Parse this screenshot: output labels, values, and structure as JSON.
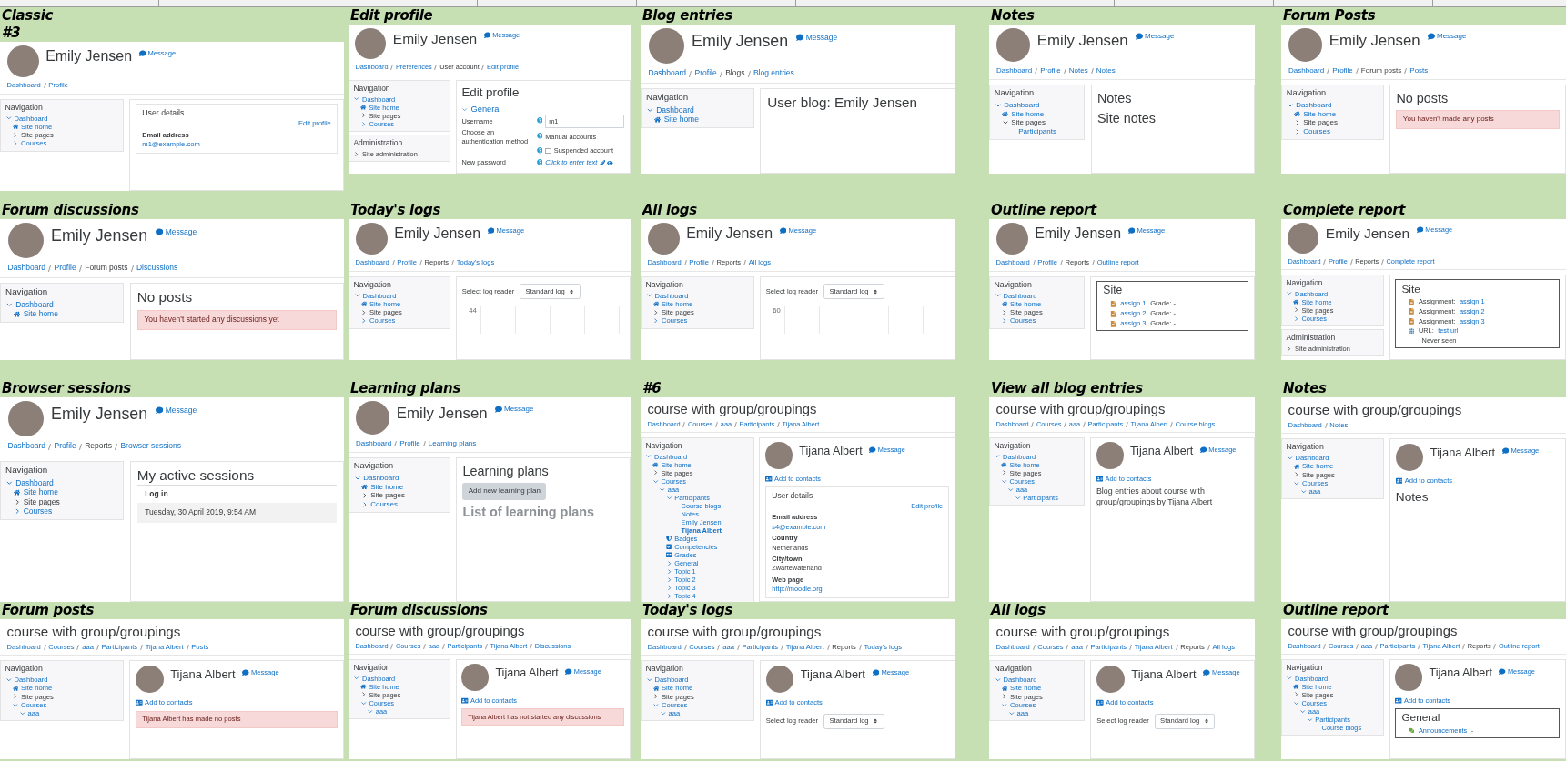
{
  "tiles": [
    {
      "caption": [
        "Classic",
        "#3"
      ],
      "header": {
        "kind": "user",
        "title": "Emily Jensen",
        "message": "Message"
      },
      "breadcrumb": [
        {
          "text": "Dashboard",
          "link": true
        },
        {
          "text": "Profile",
          "link": true
        }
      ],
      "nav": {
        "title": "Navigation",
        "items": [
          {
            "text": "Dashboard",
            "kind": "node",
            "expanded": true,
            "link": true,
            "children": [
              {
                "text": "Site home",
                "kind": "home",
                "link": true
              },
              {
                "text": "Site pages",
                "kind": "node",
                "expanded": false,
                "link": false
              },
              {
                "text": "Courses",
                "kind": "node",
                "expanded": false,
                "link": true
              }
            ]
          }
        ]
      },
      "main": [
        {
          "kind": "card",
          "title": "User details",
          "action": "Edit profile",
          "fields": [
            {
              "label": "Email address",
              "value": "m1@example.com",
              "link": true
            }
          ]
        }
      ]
    },
    {
      "caption": [
        "Edit profile"
      ],
      "header": {
        "kind": "user",
        "title": "Emily Jensen",
        "message": "Message"
      },
      "breadcrumb": [
        {
          "text": "Dashboard",
          "link": true
        },
        {
          "text": "Preferences",
          "link": true
        },
        {
          "text": "User account",
          "link": false
        },
        {
          "text": "Edit profile",
          "link": true
        }
      ],
      "nav": {
        "title": "Navigation",
        "items": [
          {
            "text": "Dashboard",
            "kind": "node",
            "expanded": true,
            "link": true,
            "children": [
              {
                "text": "Site home",
                "kind": "home",
                "link": true
              },
              {
                "text": "Site pages",
                "kind": "node",
                "expanded": false,
                "link": false
              },
              {
                "text": "Courses",
                "kind": "node",
                "expanded": false,
                "link": true
              }
            ]
          }
        ]
      },
      "admin": {
        "title": "Administration",
        "items": [
          {
            "text": "Site administration",
            "kind": "node",
            "expanded": false,
            "link": false
          }
        ]
      },
      "main": [
        {
          "kind": "heading",
          "text": "Edit profile"
        },
        {
          "kind": "form",
          "section": "General",
          "expanded": true,
          "rows": [
            {
              "label": "Username",
              "help": true,
              "kind": "input",
              "value": "m1"
            },
            {
              "label": "Choose an authentication method",
              "help": true,
              "kind": "text",
              "value": "Manual accounts"
            },
            {
              "kind": "checkbox",
              "value": "Suspended account",
              "checked": false,
              "help": true
            },
            {
              "label": "New password",
              "help": true,
              "kind": "editable",
              "value": "Click to enter text"
            }
          ]
        }
      ]
    },
    {
      "caption": [
        "Blog entries"
      ],
      "header": {
        "kind": "user",
        "title": "Emily Jensen",
        "message": "Message"
      },
      "breadcrumb": [
        {
          "text": "Dashboard",
          "link": true
        },
        {
          "text": "Profile",
          "link": true
        },
        {
          "text": "Blogs",
          "link": false
        },
        {
          "text": "Blog entries",
          "link": true
        }
      ],
      "nav": {
        "title": "Navigation",
        "items": [
          {
            "text": "Dashboard",
            "kind": "node",
            "expanded": true,
            "link": true,
            "children": [
              {
                "text": "Site home",
                "kind": "home",
                "link": true
              }
            ]
          }
        ]
      },
      "main": [
        {
          "kind": "heading",
          "text": "User blog: Emily Jensen"
        }
      ]
    },
    {
      "caption": [
        "Notes"
      ],
      "header": {
        "kind": "user",
        "title": "Emily Jensen",
        "message": "Message"
      },
      "breadcrumb": [
        {
          "text": "Dashboard",
          "link": true
        },
        {
          "text": "Profile",
          "link": true
        },
        {
          "text": "Notes",
          "link": true
        },
        {
          "text": "Notes",
          "link": true
        }
      ],
      "nav": {
        "title": "Navigation",
        "items": [
          {
            "text": "Dashboard",
            "kind": "node",
            "expanded": true,
            "link": true,
            "children": [
              {
                "text": "Site home",
                "kind": "home",
                "link": true
              },
              {
                "text": "Site pages",
                "kind": "node",
                "expanded": true,
                "link": false,
                "children": [
                  {
                    "text": "Participants",
                    "kind": "leaf",
                    "link": true
                  }
                ]
              }
            ]
          }
        ]
      },
      "main": [
        {
          "kind": "heading",
          "text": "Notes"
        },
        {
          "kind": "heading",
          "text": "Site notes"
        }
      ]
    },
    {
      "caption": [
        "Forum Posts"
      ],
      "header": {
        "kind": "user",
        "title": "Emily Jensen",
        "message": "Message"
      },
      "breadcrumb": [
        {
          "text": "Dashboard",
          "link": true
        },
        {
          "text": "Profile",
          "link": true
        },
        {
          "text": "Forum posts",
          "link": false
        },
        {
          "text": "Posts",
          "link": true
        }
      ],
      "nav": {
        "title": "Navigation",
        "items": [
          {
            "text": "Dashboard",
            "kind": "node",
            "expanded": true,
            "link": true,
            "children": [
              {
                "text": "Site home",
                "kind": "home",
                "link": true
              },
              {
                "text": "Site pages",
                "kind": "node",
                "expanded": false,
                "link": false
              },
              {
                "text": "Courses",
                "kind": "node",
                "expanded": false,
                "link": true
              }
            ]
          }
        ]
      },
      "main": [
        {
          "kind": "heading",
          "text": "No posts"
        },
        {
          "kind": "alert",
          "text": "You haven't made any posts"
        }
      ]
    },
    {
      "caption": [
        "Forum discussions"
      ],
      "header": {
        "kind": "user",
        "title": "Emily Jensen",
        "message": "Message"
      },
      "breadcrumb": [
        {
          "text": "Dashboard",
          "link": true
        },
        {
          "text": "Profile",
          "link": true
        },
        {
          "text": "Forum posts",
          "link": false
        },
        {
          "text": "Discussions",
          "link": true
        }
      ],
      "nav": {
        "title": "Navigation",
        "items": [
          {
            "text": "Dashboard",
            "kind": "node",
            "expanded": true,
            "link": true,
            "children": [
              {
                "text": "Site home",
                "kind": "home",
                "link": true
              }
            ]
          }
        ]
      },
      "main": [
        {
          "kind": "heading",
          "text": "No posts"
        },
        {
          "kind": "alert",
          "text": "You haven't started any discussions yet"
        }
      ]
    },
    {
      "caption": [
        "Today's logs"
      ],
      "header": {
        "kind": "user",
        "title": "Emily Jensen",
        "message": "Message"
      },
      "breadcrumb": [
        {
          "text": "Dashboard",
          "link": true
        },
        {
          "text": "Profile",
          "link": true
        },
        {
          "text": "Reports",
          "link": false
        },
        {
          "text": "Today's logs",
          "link": true
        }
      ],
      "nav": {
        "title": "Navigation",
        "items": [
          {
            "text": "Dashboard",
            "kind": "node",
            "expanded": true,
            "link": true,
            "children": [
              {
                "text": "Site home",
                "kind": "home",
                "link": true
              },
              {
                "text": "Site pages",
                "kind": "node",
                "expanded": false,
                "link": false
              },
              {
                "text": "Courses",
                "kind": "node",
                "expanded": false,
                "link": true
              }
            ]
          }
        ]
      },
      "main": [
        {
          "kind": "logs",
          "label": "Select log reader",
          "value": "Standard log",
          "tick": "44"
        }
      ]
    },
    {
      "caption": [
        "All logs"
      ],
      "header": {
        "kind": "user",
        "title": "Emily Jensen",
        "message": "Message"
      },
      "breadcrumb": [
        {
          "text": "Dashboard",
          "link": true
        },
        {
          "text": "Profile",
          "link": true
        },
        {
          "text": "Reports",
          "link": false
        },
        {
          "text": "All logs",
          "link": true
        }
      ],
      "nav": {
        "title": "Navigation",
        "items": [
          {
            "text": "Dashboard",
            "kind": "node",
            "expanded": true,
            "link": true,
            "children": [
              {
                "text": "Site home",
                "kind": "home",
                "link": true
              },
              {
                "text": "Site pages",
                "kind": "node",
                "expanded": false,
                "link": false
              },
              {
                "text": "Courses",
                "kind": "node",
                "expanded": false,
                "link": true
              }
            ]
          }
        ]
      },
      "main": [
        {
          "kind": "logs",
          "label": "Select log reader",
          "value": "Standard log",
          "tick": "60"
        }
      ]
    },
    {
      "caption": [
        "Outline report"
      ],
      "header": {
        "kind": "user",
        "title": "Emily Jensen",
        "message": "Message"
      },
      "breadcrumb": [
        {
          "text": "Dashboard",
          "link": true
        },
        {
          "text": "Profile",
          "link": true
        },
        {
          "text": "Reports",
          "link": false
        },
        {
          "text": "Outline report",
          "link": true
        }
      ],
      "nav": {
        "title": "Navigation",
        "items": [
          {
            "text": "Dashboard",
            "kind": "node",
            "expanded": true,
            "link": true,
            "children": [
              {
                "text": "Site home",
                "kind": "home",
                "link": true
              },
              {
                "text": "Site pages",
                "kind": "node",
                "expanded": false,
                "link": false
              },
              {
                "text": "Courses",
                "kind": "node",
                "expanded": false,
                "link": true
              }
            ]
          }
        ]
      },
      "main": [
        {
          "kind": "report",
          "title": "Site",
          "rows": [
            {
              "kind": "assign",
              "link": "assign 1",
              "after": "Grade: -"
            },
            {
              "kind": "assign",
              "link": "assign 2",
              "after": "Grade: -"
            },
            {
              "kind": "assign",
              "link": "assign 3",
              "after": "Grade: -"
            }
          ]
        }
      ]
    },
    {
      "caption": [
        "Complete report"
      ],
      "header": {
        "kind": "user",
        "title": "Emily Jensen",
        "message": "Message"
      },
      "breadcrumb": [
        {
          "text": "Dashboard",
          "link": true
        },
        {
          "text": "Profile",
          "link": true
        },
        {
          "text": "Reports",
          "link": false
        },
        {
          "text": "Complete report",
          "link": true
        }
      ],
      "nav": {
        "title": "Navigation",
        "items": [
          {
            "text": "Dashboard",
            "kind": "node",
            "expanded": true,
            "link": true,
            "children": [
              {
                "text": "Site home",
                "kind": "home",
                "link": true
              },
              {
                "text": "Site pages",
                "kind": "node",
                "expanded": false,
                "link": false
              },
              {
                "text": "Courses",
                "kind": "node",
                "expanded": false,
                "link": true
              }
            ]
          }
        ]
      },
      "admin": {
        "title": "Administration",
        "items": [
          {
            "text": "Site administration",
            "kind": "node",
            "expanded": false,
            "link": false
          }
        ]
      },
      "main": [
        {
          "kind": "report",
          "title": "Site",
          "rows": [
            {
              "kind": "assign",
              "before": "Assignment:",
              "link": "assign 1"
            },
            {
              "kind": "assign",
              "before": "Assignment:",
              "link": "assign 2"
            },
            {
              "kind": "assign",
              "before": "Assignment:",
              "link": "assign 3"
            },
            {
              "kind": "url",
              "before": "URL:",
              "link": "test url"
            }
          ],
          "note": "Never seen"
        }
      ]
    },
    {
      "caption": [
        "Browser sessions"
      ],
      "header": {
        "kind": "user",
        "title": "Emily Jensen",
        "message": "Message"
      },
      "breadcrumb": [
        {
          "text": "Dashboard",
          "link": true
        },
        {
          "text": "Profile",
          "link": true
        },
        {
          "text": "Reports",
          "link": false
        },
        {
          "text": "Browser sessions",
          "link": true
        }
      ],
      "nav": {
        "title": "Navigation",
        "items": [
          {
            "text": "Dashboard",
            "kind": "node",
            "expanded": true,
            "link": true,
            "children": [
              {
                "text": "Site home",
                "kind": "home",
                "link": true
              },
              {
                "text": "Site pages",
                "kind": "node",
                "expanded": false,
                "link": false
              },
              {
                "text": "Courses",
                "kind": "node",
                "expanded": false,
                "link": true
              }
            ]
          }
        ]
      },
      "main": [
        {
          "kind": "sessions",
          "title": "My active sessions",
          "column": "Log in",
          "row": "Tuesday, 30 April 2019, 9:54 AM"
        }
      ]
    },
    {
      "caption": [
        "Learning plans"
      ],
      "header": {
        "kind": "user",
        "title": "Emily Jensen",
        "message": "Message"
      },
      "breadcrumb": [
        {
          "text": "Dashboard",
          "link": true
        },
        {
          "text": "Profile",
          "link": true
        },
        {
          "text": "Learning plans",
          "link": true
        }
      ],
      "nav": {
        "title": "Navigation",
        "items": [
          {
            "text": "Dashboard",
            "kind": "node",
            "expanded": true,
            "link": true,
            "children": [
              {
                "text": "Site home",
                "kind": "home",
                "link": true
              },
              {
                "text": "Site pages",
                "kind": "node",
                "expanded": false,
                "link": false
              },
              {
                "text": "Courses",
                "kind": "node",
                "expanded": false,
                "link": true
              }
            ]
          }
        ]
      },
      "main": [
        {
          "kind": "heading",
          "text": "Learning plans"
        },
        {
          "kind": "button",
          "text": "Add new learning plan"
        },
        {
          "kind": "heading",
          "text": "List of learning plans",
          "muted": true
        }
      ]
    },
    {
      "caption": [
        "#6"
      ],
      "header": {
        "kind": "course",
        "title": "course with group/groupings"
      },
      "breadcrumb": [
        {
          "text": "Dashboard",
          "link": true
        },
        {
          "text": "Courses",
          "link": true
        },
        {
          "text": "aaa",
          "link": true
        },
        {
          "text": "Participants",
          "link": true
        },
        {
          "text": "Tijana Albert",
          "link": true
        }
      ],
      "nav": {
        "title": "Navigation",
        "items": [
          {
            "text": "Dashboard",
            "kind": "node",
            "expanded": true,
            "link": true,
            "children": [
              {
                "text": "Site home",
                "kind": "home",
                "link": true
              },
              {
                "text": "Site pages",
                "kind": "node",
                "expanded": false,
                "link": false
              },
              {
                "text": "Courses",
                "kind": "node",
                "expanded": true,
                "link": true,
                "children": [
                  {
                    "text": "aaa",
                    "kind": "node",
                    "expanded": true,
                    "link": true,
                    "children": [
                      {
                        "text": "Participants",
                        "kind": "node",
                        "expanded": true,
                        "link": true,
                        "children": [
                          {
                            "text": "Course blogs",
                            "kind": "leaf",
                            "link": true
                          },
                          {
                            "text": "Notes",
                            "kind": "leaf",
                            "link": true
                          },
                          {
                            "text": "Emily Jensen",
                            "kind": "leaf",
                            "link": true
                          },
                          {
                            "text": "Tijana Albert",
                            "kind": "leaf",
                            "link": true,
                            "current": true
                          }
                        ]
                      },
                      {
                        "text": "Badges",
                        "kind": "badges",
                        "link": true
                      },
                      {
                        "text": "Competencies",
                        "kind": "competencies",
                        "link": true
                      },
                      {
                        "text": "Grades",
                        "kind": "grades",
                        "link": true
                      },
                      {
                        "text": "General",
                        "kind": "node",
                        "expanded": false,
                        "link": true
                      },
                      {
                        "text": "Topic 1",
                        "kind": "node",
                        "expanded": false,
                        "link": true
                      },
                      {
                        "text": "Topic 2",
                        "kind": "node",
                        "expanded": false,
                        "link": true
                      },
                      {
                        "text": "Topic 3",
                        "kind": "node",
                        "expanded": false,
                        "link": true
                      },
                      {
                        "text": "Topic 4",
                        "kind": "node",
                        "expanded": false,
                        "link": true
                      }
                    ]
                  }
                ]
              }
            ]
          }
        ]
      },
      "main": [
        {
          "kind": "user",
          "name": "Tijana Albert",
          "message": "Message",
          "contacts": "Add to contacts"
        },
        {
          "kind": "card",
          "title": "User details",
          "action": "Edit profile",
          "fields": [
            {
              "label": "Email address",
              "value": "s4@example.com",
              "link": true
            },
            {
              "label": "Country",
              "value": "Netherlands",
              "link": false
            },
            {
              "label": "City/town",
              "value": "Zwartewaterland",
              "link": false
            },
            {
              "label": "Web page",
              "value": "http://moodle.org",
              "link": true
            }
          ]
        }
      ]
    },
    {
      "caption": [
        "View all blog entries"
      ],
      "header": {
        "kind": "course",
        "title": "course with group/groupings"
      },
      "breadcrumb": [
        {
          "text": "Dashboard",
          "link": true
        },
        {
          "text": "Courses",
          "link": true
        },
        {
          "text": "aaa",
          "link": true
        },
        {
          "text": "Participants",
          "link": true
        },
        {
          "text": "Tijana Albert",
          "link": true
        },
        {
          "text": "Course blogs",
          "link": true
        }
      ],
      "nav": {
        "title": "Navigation",
        "items": [
          {
            "text": "Dashboard",
            "kind": "node",
            "expanded": true,
            "link": true,
            "children": [
              {
                "text": "Site home",
                "kind": "home",
                "link": true
              },
              {
                "text": "Site pages",
                "kind": "node",
                "expanded": false,
                "link": false
              },
              {
                "text": "Courses",
                "kind": "node",
                "expanded": true,
                "link": true,
                "children": [
                  {
                    "text": "aaa",
                    "kind": "node",
                    "expanded": true,
                    "link": true,
                    "children": [
                      {
                        "text": "Participants",
                        "kind": "node",
                        "expanded": true,
                        "link": true
                      }
                    ]
                  }
                ]
              }
            ]
          }
        ]
      },
      "main": [
        {
          "kind": "user",
          "name": "Tijana Albert",
          "message": "Message",
          "contacts": "Add to contacts"
        },
        {
          "kind": "text",
          "text": "Blog entries about course with group/groupings by Tijana Albert"
        }
      ]
    },
    {
      "caption": [
        "Notes"
      ],
      "header": {
        "kind": "course",
        "title": "course with group/groupings"
      },
      "breadcrumb": [
        {
          "text": "Dashboard",
          "link": true
        },
        {
          "text": "Notes",
          "link": true
        }
      ],
      "nav": {
        "title": "Navigation",
        "items": [
          {
            "text": "Dashboard",
            "kind": "node",
            "expanded": true,
            "link": true,
            "children": [
              {
                "text": "Site home",
                "kind": "home",
                "link": true
              },
              {
                "text": "Site pages",
                "kind": "node",
                "expanded": false,
                "link": false
              },
              {
                "text": "Courses",
                "kind": "node",
                "expanded": true,
                "link": true,
                "children": [
                  {
                    "text": "aaa",
                    "kind": "node",
                    "expanded": true,
                    "link": true
                  }
                ]
              }
            ]
          }
        ]
      },
      "main": [
        {
          "kind": "user",
          "name": "Tijana Albert",
          "message": "Message",
          "contacts": "Add to contacts"
        },
        {
          "kind": "heading",
          "text": "Notes"
        }
      ]
    },
    {
      "caption": [
        "Forum posts"
      ],
      "header": {
        "kind": "course",
        "title": "course with group/groupings"
      },
      "breadcrumb": [
        {
          "text": "Dashboard",
          "link": true
        },
        {
          "text": "Courses",
          "link": true
        },
        {
          "text": "aaa",
          "link": true
        },
        {
          "text": "Participants",
          "link": true
        },
        {
          "text": "Tijana Albert",
          "link": true
        },
        {
          "text": "Posts",
          "link": true
        }
      ],
      "nav": {
        "title": "Navigation",
        "items": [
          {
            "text": "Dashboard",
            "kind": "node",
            "expanded": true,
            "link": true,
            "children": [
              {
                "text": "Site home",
                "kind": "home",
                "link": true
              },
              {
                "text": "Site pages",
                "kind": "node",
                "expanded": false,
                "link": false
              },
              {
                "text": "Courses",
                "kind": "node",
                "expanded": true,
                "link": true,
                "children": [
                  {
                    "text": "aaa",
                    "kind": "node",
                    "expanded": true,
                    "link": true
                  }
                ]
              }
            ]
          }
        ]
      },
      "main": [
        {
          "kind": "user",
          "name": "Tijana Albert",
          "message": "Message",
          "contacts": "Add to contacts"
        },
        {
          "kind": "alert",
          "text": "Tijana Albert has made no posts"
        }
      ]
    },
    {
      "caption": [
        "Forum discussions"
      ],
      "header": {
        "kind": "course",
        "title": "course with group/groupings"
      },
      "breadcrumb": [
        {
          "text": "Dashboard",
          "link": true
        },
        {
          "text": "Courses",
          "link": true
        },
        {
          "text": "aaa",
          "link": true
        },
        {
          "text": "Participants",
          "link": true
        },
        {
          "text": "Tijana Albert",
          "link": true
        },
        {
          "text": "Discussions",
          "link": true
        }
      ],
      "nav": {
        "title": "Navigation",
        "items": [
          {
            "text": "Dashboard",
            "kind": "node",
            "expanded": true,
            "link": true,
            "children": [
              {
                "text": "Site home",
                "kind": "home",
                "link": true
              },
              {
                "text": "Site pages",
                "kind": "node",
                "expanded": false,
                "link": false
              },
              {
                "text": "Courses",
                "kind": "node",
                "expanded": true,
                "link": true,
                "children": [
                  {
                    "text": "aaa",
                    "kind": "node",
                    "expanded": true,
                    "link": true
                  }
                ]
              }
            ]
          }
        ]
      },
      "main": [
        {
          "kind": "user",
          "name": "Tijana Albert",
          "message": "Message",
          "contacts": "Add to contacts"
        },
        {
          "kind": "alert",
          "text": "Tijana Albert has not started any discussions"
        }
      ]
    },
    {
      "caption": [
        "Today's logs"
      ],
      "header": {
        "kind": "course",
        "title": "course with group/groupings"
      },
      "breadcrumb": [
        {
          "text": "Dashboard",
          "link": true
        },
        {
          "text": "Courses",
          "link": true
        },
        {
          "text": "aaa",
          "link": true
        },
        {
          "text": "Participants",
          "link": true
        },
        {
          "text": "Tijana Albert",
          "link": true
        },
        {
          "text": "Reports",
          "link": false
        },
        {
          "text": "Today's logs",
          "link": true
        }
      ],
      "nav": {
        "title": "Navigation",
        "items": [
          {
            "text": "Dashboard",
            "kind": "node",
            "expanded": true,
            "link": true,
            "children": [
              {
                "text": "Site home",
                "kind": "home",
                "link": true
              },
              {
                "text": "Site pages",
                "kind": "node",
                "expanded": false,
                "link": false
              },
              {
                "text": "Courses",
                "kind": "node",
                "expanded": true,
                "link": true,
                "children": [
                  {
                    "text": "aaa",
                    "kind": "node",
                    "expanded": true,
                    "link": true
                  }
                ]
              }
            ]
          }
        ]
      },
      "main": [
        {
          "kind": "user",
          "name": "Tijana Albert",
          "message": "Message",
          "contacts": "Add to contacts"
        },
        {
          "kind": "logs",
          "label": "Select log reader",
          "value": "Standard log"
        }
      ]
    },
    {
      "caption": [
        "All logs"
      ],
      "header": {
        "kind": "course",
        "title": "course with group/groupings"
      },
      "breadcrumb": [
        {
          "text": "Dashboard",
          "link": true
        },
        {
          "text": "Courses",
          "link": true
        },
        {
          "text": "aaa",
          "link": true
        },
        {
          "text": "Participants",
          "link": true
        },
        {
          "text": "Tijana Albert",
          "link": true
        },
        {
          "text": "Reports",
          "link": false
        },
        {
          "text": "All logs",
          "link": true
        }
      ],
      "nav": {
        "title": "Navigation",
        "items": [
          {
            "text": "Dashboard",
            "kind": "node",
            "expanded": true,
            "link": true,
            "children": [
              {
                "text": "Site home",
                "kind": "home",
                "link": true
              },
              {
                "text": "Site pages",
                "kind": "node",
                "expanded": false,
                "link": false
              },
              {
                "text": "Courses",
                "kind": "node",
                "expanded": true,
                "link": true,
                "children": [
                  {
                    "text": "aaa",
                    "kind": "node",
                    "expanded": true,
                    "link": true
                  }
                ]
              }
            ]
          }
        ]
      },
      "main": [
        {
          "kind": "user",
          "name": "Tijana Albert",
          "message": "Message",
          "contacts": "Add to contacts"
        },
        {
          "kind": "logs",
          "label": "Select log reader",
          "value": "Standard log"
        }
      ]
    },
    {
      "caption": [
        "Outline report"
      ],
      "header": {
        "kind": "course",
        "title": "course with group/groupings"
      },
      "breadcrumb": [
        {
          "text": "Dashboard",
          "link": true
        },
        {
          "text": "Courses",
          "link": true
        },
        {
          "text": "aaa",
          "link": true
        },
        {
          "text": "Participants",
          "link": true
        },
        {
          "text": "Tijana Albert",
          "link": true
        },
        {
          "text": "Reports",
          "link": false
        },
        {
          "text": "Outline report",
          "link": true
        }
      ],
      "nav": {
        "title": "Navigation",
        "items": [
          {
            "text": "Dashboard",
            "kind": "node",
            "expanded": true,
            "link": true,
            "children": [
              {
                "text": "Site home",
                "kind": "home",
                "link": true
              },
              {
                "text": "Site pages",
                "kind": "node",
                "expanded": false,
                "link": false
              },
              {
                "text": "Courses",
                "kind": "node",
                "expanded": true,
                "link": true,
                "children": [
                  {
                    "text": "aaa",
                    "kind": "node",
                    "expanded": true,
                    "link": true,
                    "children": [
                      {
                        "text": "Participants",
                        "kind": "node",
                        "expanded": true,
                        "link": true,
                        "children": [
                          {
                            "text": "Course blogs",
                            "kind": "leaf",
                            "link": true
                          }
                        ]
                      }
                    ]
                  }
                ]
              }
            ]
          }
        ]
      },
      "main": [
        {
          "kind": "user",
          "name": "Tijana Albert",
          "message": "Message",
          "contacts": "Add to contacts"
        },
        {
          "kind": "report",
          "title": "General",
          "rows": [
            {
              "kind": "forum",
              "link": "Announcements",
              "after": "-"
            }
          ]
        }
      ]
    }
  ]
}
